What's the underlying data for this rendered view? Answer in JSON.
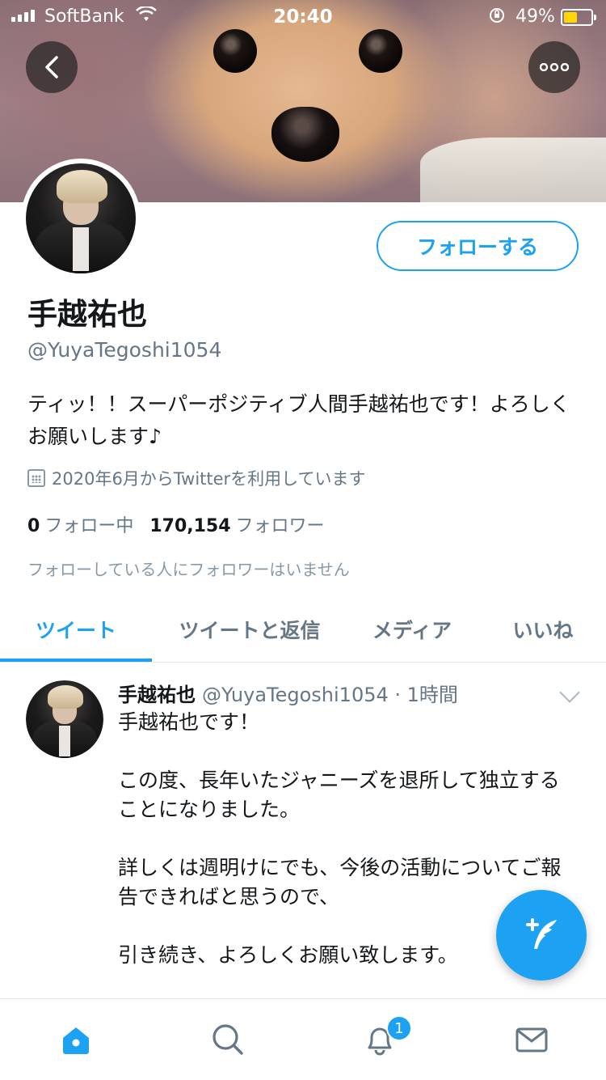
{
  "status_bar": {
    "carrier": "SoftBank",
    "time": "20:40",
    "battery_percent": "49%",
    "battery_level": 0.49,
    "battery_color": "#ffd60a"
  },
  "header": {
    "back_icon": "chevron-left-icon",
    "more_icon": "ellipsis-icon"
  },
  "profile": {
    "follow_label": "フォローする",
    "name": "手越祐也",
    "handle": "@YuyaTegoshi1054",
    "bio": "ティッ！！スーパーポジティブ人間手越祐也です！よろしくお願いします♪",
    "joined": "2020年6月からTwitterを利用しています",
    "following_count": "0",
    "following_label": "フォロー中",
    "followers_count": "170,154",
    "followers_label": "フォロワー",
    "mutual_note": "フォローしている人にフォロワーはいません"
  },
  "tabs": [
    {
      "label": "ツイート",
      "active": true
    },
    {
      "label": "ツイートと返信",
      "active": false
    },
    {
      "label": "メディア",
      "active": false
    },
    {
      "label": "いいね",
      "active": false
    }
  ],
  "tweet": {
    "name": "手越祐也",
    "handle": "@YuyaTegoshi1054",
    "time": "· 1時間",
    "lines": [
      "手越祐也です！",
      "",
      "この度、長年いたジャニーズを退所して独立することになりました。",
      "",
      "詳しくは週明けにでも、今後の活動についてご報告できればと思うので、",
      "",
      "引き続き、よろしくお願い致します。"
    ]
  },
  "fab": {
    "icon": "compose-tweet-icon"
  },
  "bottom_nav": {
    "items": [
      "home-icon",
      "search-icon",
      "notifications-icon",
      "messages-icon"
    ],
    "notification_badge": "1"
  },
  "colors": {
    "accent": "#1da1f2",
    "text": "#14171a",
    "secondary": "#657786"
  }
}
